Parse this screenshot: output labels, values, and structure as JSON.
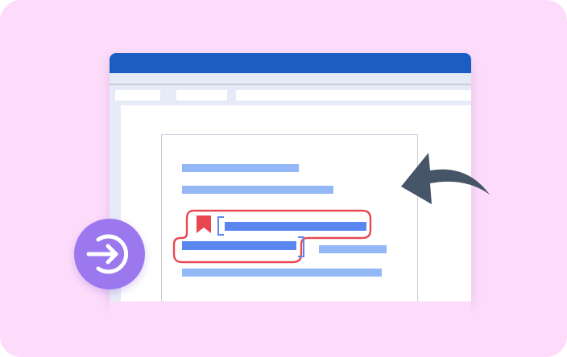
{
  "illustration": {
    "subject": "document-window",
    "icons": {
      "back_arrow": "curved-back-arrow-icon",
      "enter": "enter-circle-arrow-icon",
      "bookmark": "bookmark-icon"
    },
    "colors": {
      "background": "#fddcfb",
      "titlebar": "#1b5dc2",
      "toolbar": "#e6ebf7",
      "text_light": "#94b8f5",
      "text_dark": "#5a86f0",
      "highlight": "#e8474f",
      "arrow": "#475569",
      "enter_button": "#9b78ee"
    }
  }
}
